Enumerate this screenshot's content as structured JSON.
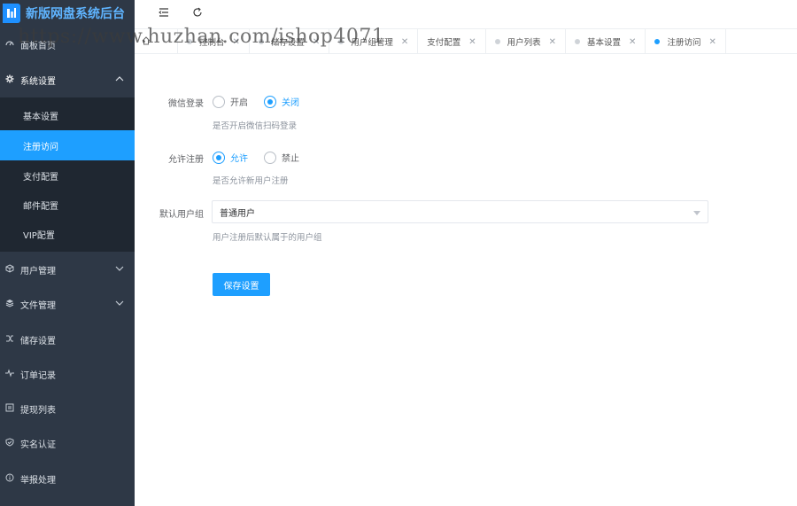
{
  "brand": {
    "title": "新版网盘系统后台"
  },
  "sidebar": {
    "items": [
      {
        "label": "面板首页",
        "icon": "gauge-icon"
      },
      {
        "label": "系统设置",
        "icon": "gear-icon",
        "expanded": true
      },
      {
        "label": "用户管理",
        "icon": "cube-icon"
      },
      {
        "label": "文件管理",
        "icon": "layers-icon"
      },
      {
        "label": "储存设置",
        "icon": "shuffle-icon"
      },
      {
        "label": "订单记录",
        "icon": "pulse-icon"
      },
      {
        "label": "提现列表",
        "icon": "list-icon"
      },
      {
        "label": "实名认证",
        "icon": "shield-icon"
      },
      {
        "label": "举报处理",
        "icon": "info-icon"
      }
    ],
    "submenu": [
      {
        "label": "基本设置"
      },
      {
        "label": "注册访问",
        "active": true
      },
      {
        "label": "支付配置"
      },
      {
        "label": "邮件配置"
      },
      {
        "label": "VIP配置"
      }
    ]
  },
  "tabs": [
    {
      "label": "控制台"
    },
    {
      "label": "储存设置"
    },
    {
      "label": "用户组管理"
    },
    {
      "label": "支付配置"
    },
    {
      "label": "用户列表"
    },
    {
      "label": "基本设置"
    },
    {
      "label": "注册访问",
      "active": true
    }
  ],
  "form": {
    "wechat_login": {
      "label": "微信登录",
      "options": [
        "开启",
        "关闭"
      ],
      "selected": "关闭",
      "help": "是否开启微信扫码登录"
    },
    "allow_register": {
      "label": "允许注册",
      "options": [
        "允许",
        "禁止"
      ],
      "selected": "允许",
      "help": "是否允许新用户注册"
    },
    "default_group": {
      "label": "默认用户组",
      "value": "普通用户",
      "help": "用户注册后默认属于的用户组"
    },
    "save_label": "保存设置"
  },
  "watermark": "https://www.huzhan.com/ishop4071",
  "colors": {
    "accent": "#1e9fff",
    "sidebar": "#2e3846",
    "submenu": "#1f2731"
  }
}
